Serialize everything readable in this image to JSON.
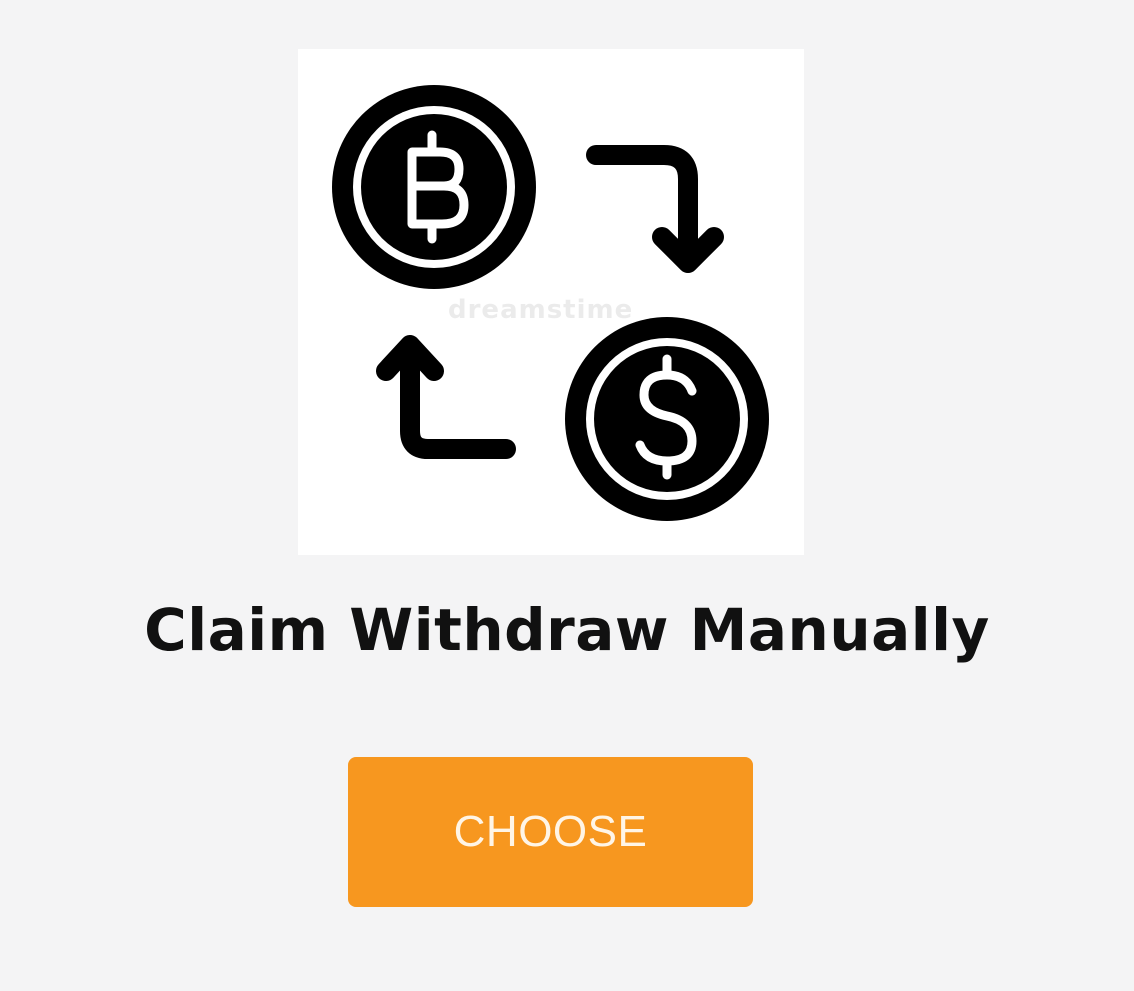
{
  "illustration": {
    "icon_name": "currency-exchange-icon",
    "watermark": "dreamstime"
  },
  "title": "Claim Withdraw Manually",
  "choose_button": {
    "label": "CHOOSE",
    "color": "#f7971f"
  }
}
